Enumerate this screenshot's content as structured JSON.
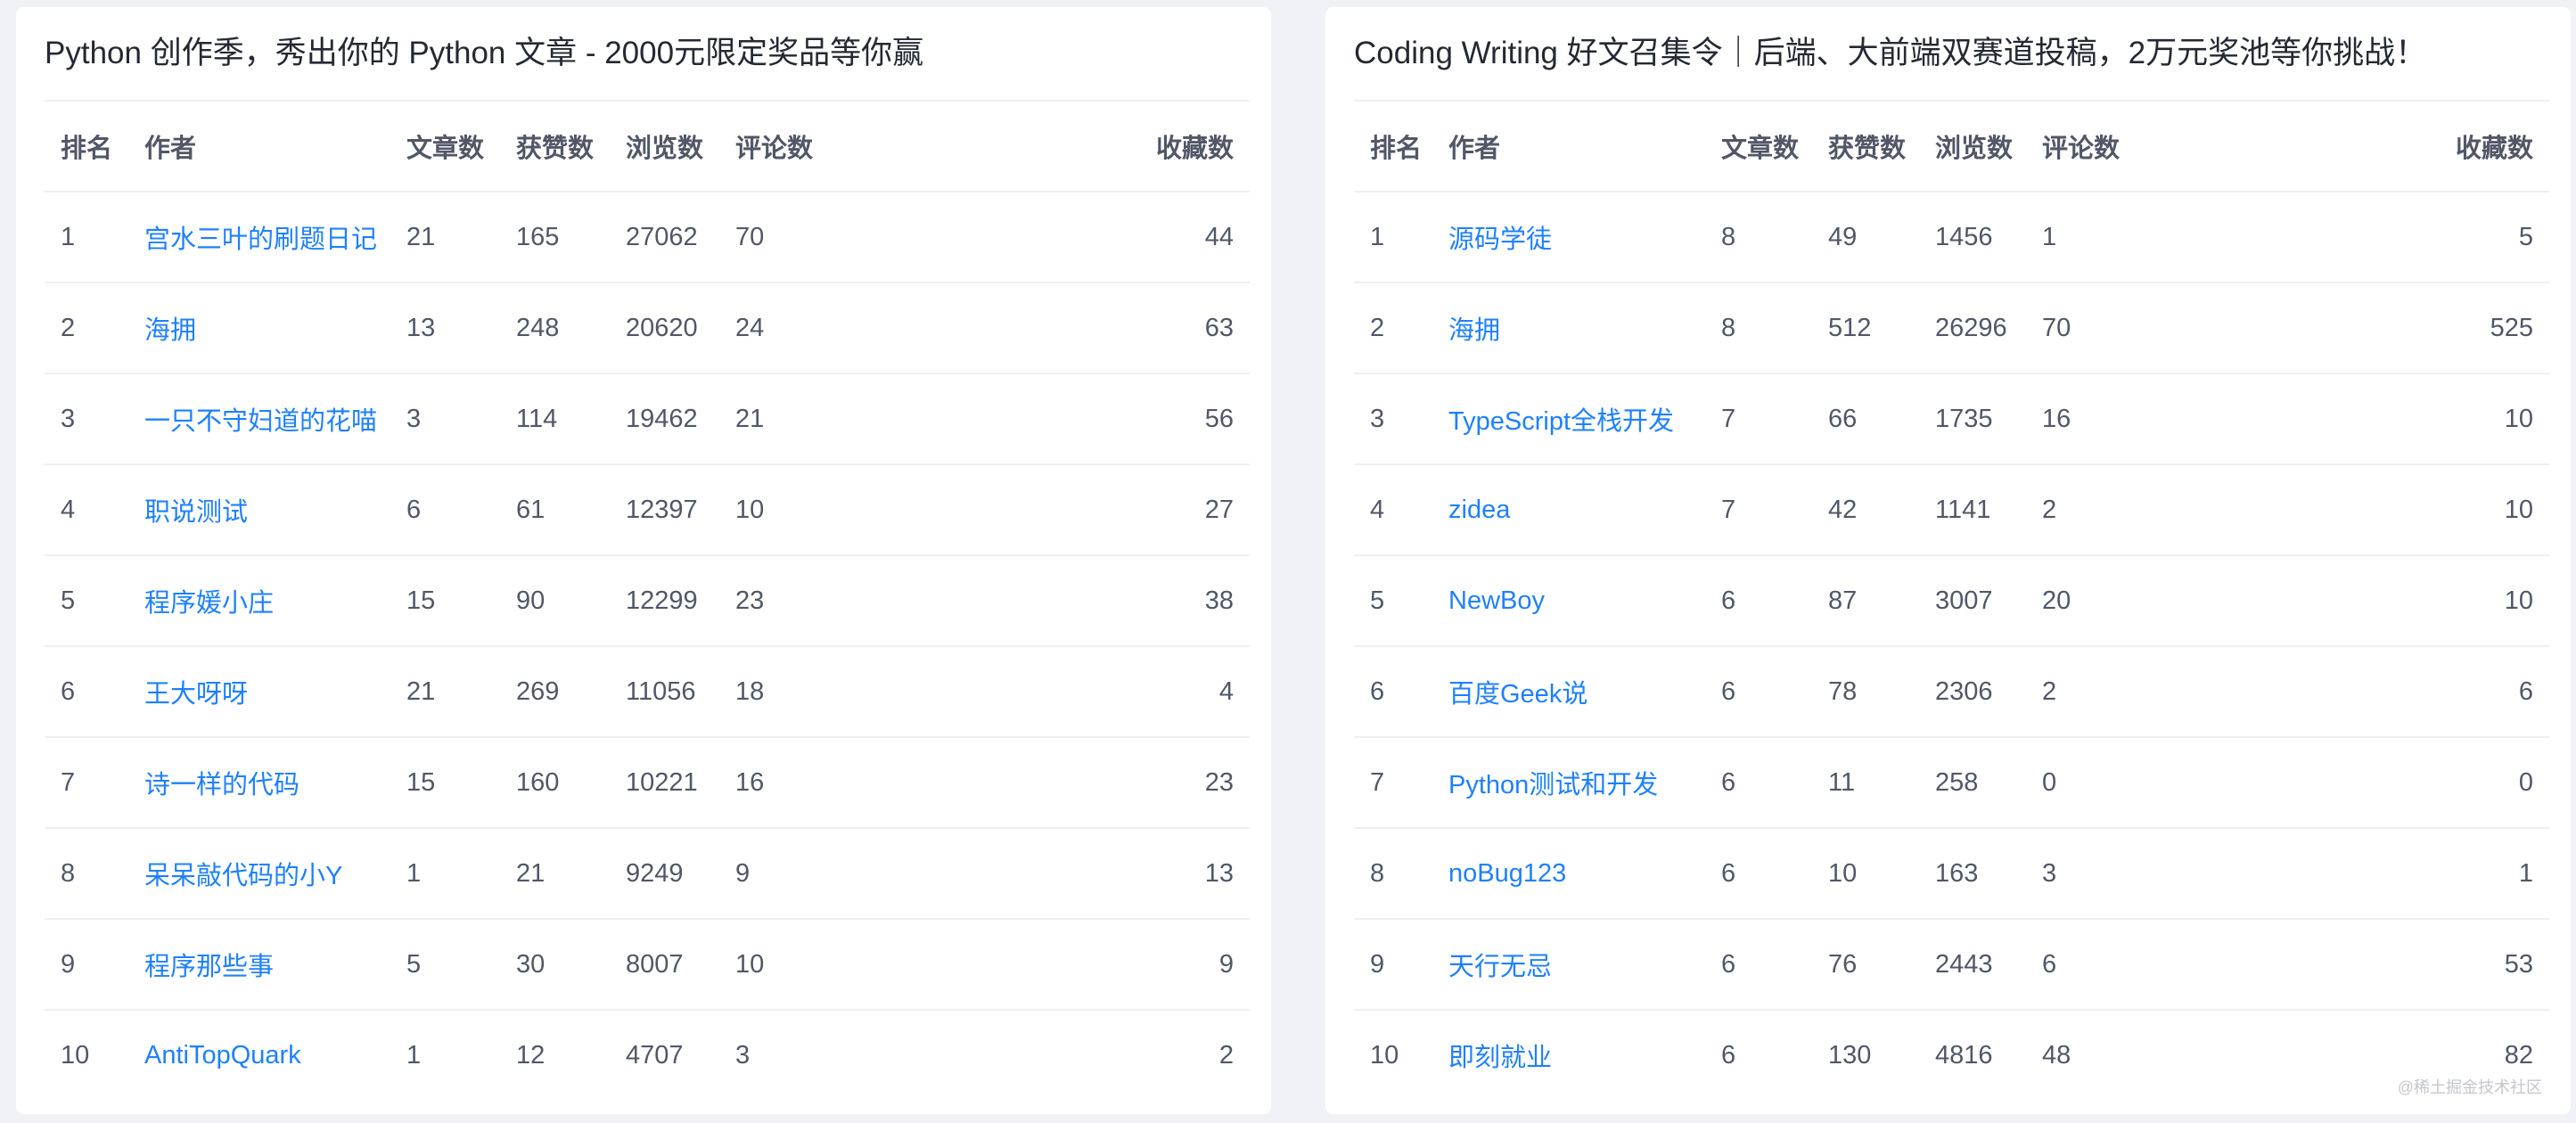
{
  "columns": [
    "排名",
    "作者",
    "文章数",
    "获赞数",
    "浏览数",
    "评论数",
    "收藏数"
  ],
  "panels": [
    {
      "title": "Python 创作季，秀出你的 Python 文章 - 2000元限定奖品等你赢",
      "rows": [
        {
          "rank": "1",
          "author": "宫水三叶的刷题日记",
          "articles": "21",
          "likes": "165",
          "views": "27062",
          "comments": "70",
          "favorites": "44"
        },
        {
          "rank": "2",
          "author": "海拥",
          "articles": "13",
          "likes": "248",
          "views": "20620",
          "comments": "24",
          "favorites": "63"
        },
        {
          "rank": "3",
          "author": "一只不守妇道的花喵",
          "articles": "3",
          "likes": "114",
          "views": "19462",
          "comments": "21",
          "favorites": "56"
        },
        {
          "rank": "4",
          "author": "职说测试",
          "articles": "6",
          "likes": "61",
          "views": "12397",
          "comments": "10",
          "favorites": "27"
        },
        {
          "rank": "5",
          "author": "程序媛小庄",
          "articles": "15",
          "likes": "90",
          "views": "12299",
          "comments": "23",
          "favorites": "38"
        },
        {
          "rank": "6",
          "author": "王大呀呀",
          "articles": "21",
          "likes": "269",
          "views": "11056",
          "comments": "18",
          "favorites": "4"
        },
        {
          "rank": "7",
          "author": "诗一样的代码",
          "articles": "15",
          "likes": "160",
          "views": "10221",
          "comments": "16",
          "favorites": "23"
        },
        {
          "rank": "8",
          "author": "呆呆敲代码的小Y",
          "articles": "1",
          "likes": "21",
          "views": "9249",
          "comments": "9",
          "favorites": "13"
        },
        {
          "rank": "9",
          "author": "程序那些事",
          "articles": "5",
          "likes": "30",
          "views": "8007",
          "comments": "10",
          "favorites": "9"
        },
        {
          "rank": "10",
          "author": "AntiTopQuark",
          "articles": "1",
          "likes": "12",
          "views": "4707",
          "comments": "3",
          "favorites": "2"
        }
      ]
    },
    {
      "title": "Coding Writing 好文召集令｜后端、大前端双赛道投稿，2万元奖池等你挑战！",
      "rows": [
        {
          "rank": "1",
          "author": "源码学徒",
          "articles": "8",
          "likes": "49",
          "views": "1456",
          "comments": "1",
          "favorites": "5"
        },
        {
          "rank": "2",
          "author": "海拥",
          "articles": "8",
          "likes": "512",
          "views": "26296",
          "comments": "70",
          "favorites": "525"
        },
        {
          "rank": "3",
          "author": "TypeScript全栈开发",
          "articles": "7",
          "likes": "66",
          "views": "1735",
          "comments": "16",
          "favorites": "10"
        },
        {
          "rank": "4",
          "author": "zidea",
          "articles": "7",
          "likes": "42",
          "views": "1141",
          "comments": "2",
          "favorites": "10"
        },
        {
          "rank": "5",
          "author": "NewBoy",
          "articles": "6",
          "likes": "87",
          "views": "3007",
          "comments": "20",
          "favorites": "10"
        },
        {
          "rank": "6",
          "author": "百度Geek说",
          "articles": "6",
          "likes": "78",
          "views": "2306",
          "comments": "2",
          "favorites": "6"
        },
        {
          "rank": "7",
          "author": "Python测试和开发",
          "articles": "6",
          "likes": "11",
          "views": "258",
          "comments": "0",
          "favorites": "0"
        },
        {
          "rank": "8",
          "author": "noBug123",
          "articles": "6",
          "likes": "10",
          "views": "163",
          "comments": "3",
          "favorites": "1"
        },
        {
          "rank": "9",
          "author": "天行无忌",
          "articles": "6",
          "likes": "76",
          "views": "2443",
          "comments": "6",
          "favorites": "53"
        },
        {
          "rank": "10",
          "author": "即刻就业",
          "articles": "6",
          "likes": "130",
          "views": "4816",
          "comments": "48",
          "favorites": "82"
        }
      ]
    }
  ],
  "watermark": "@稀土掘金技术社区",
  "colors": {
    "background": "#f0f2f5",
    "panel": "#ffffff",
    "text": "#515767",
    "title": "#252933",
    "link": "#1e80ff",
    "divider": "#eef0f3"
  }
}
